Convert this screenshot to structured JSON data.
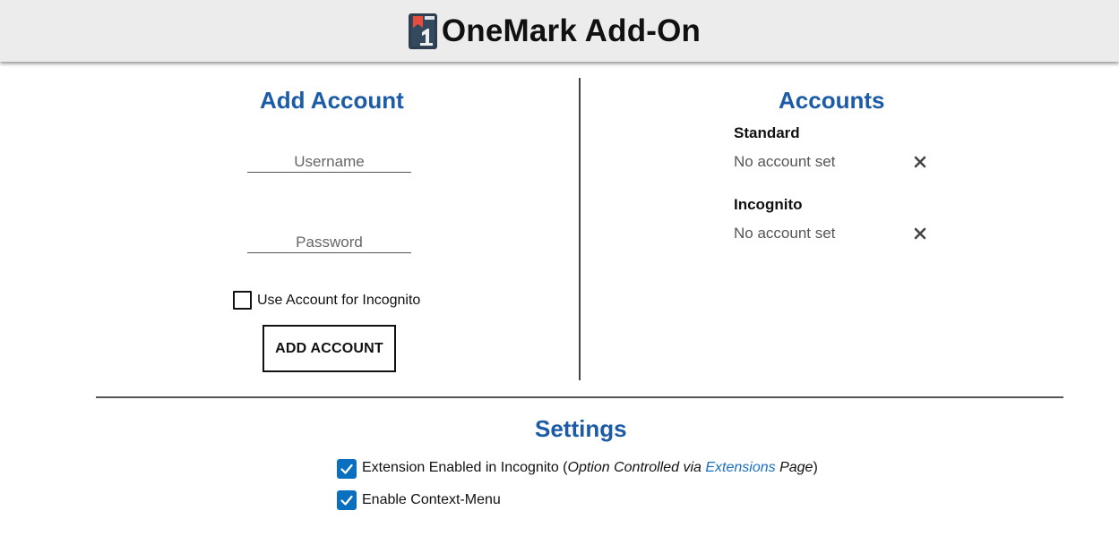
{
  "header": {
    "title": "OneMark Add-On",
    "logo_icon": "onemark-logo-icon"
  },
  "add_account": {
    "title": "Add Account",
    "username_placeholder": "Username",
    "username_value": "",
    "password_placeholder": "Password",
    "password_value": "",
    "incognito_checkbox_label": "Use Account for Incognito",
    "incognito_checked": false,
    "add_button_label": "ADD ACCOUNT"
  },
  "accounts": {
    "title": "Accounts",
    "groups": [
      {
        "heading": "Standard",
        "value": "No account set",
        "remove_icon": "close-icon"
      },
      {
        "heading": "Incognito",
        "value": "No account set",
        "remove_icon": "close-icon"
      }
    ]
  },
  "settings": {
    "title": "Settings",
    "items": [
      {
        "label": "Extension Enabled in Incognito",
        "paren_open": " (",
        "note_prefix": "Option Controlled via ",
        "link_text": "Extensions",
        "note_suffix": " Page",
        "paren_close": ")",
        "checked": true
      },
      {
        "label": "Enable Context-Menu",
        "checked": true
      }
    ]
  },
  "colors": {
    "accent": "#1c5ba6",
    "checkbox": "#0b6fc0",
    "link": "#1a6fc4",
    "header_bg": "#ececec"
  }
}
